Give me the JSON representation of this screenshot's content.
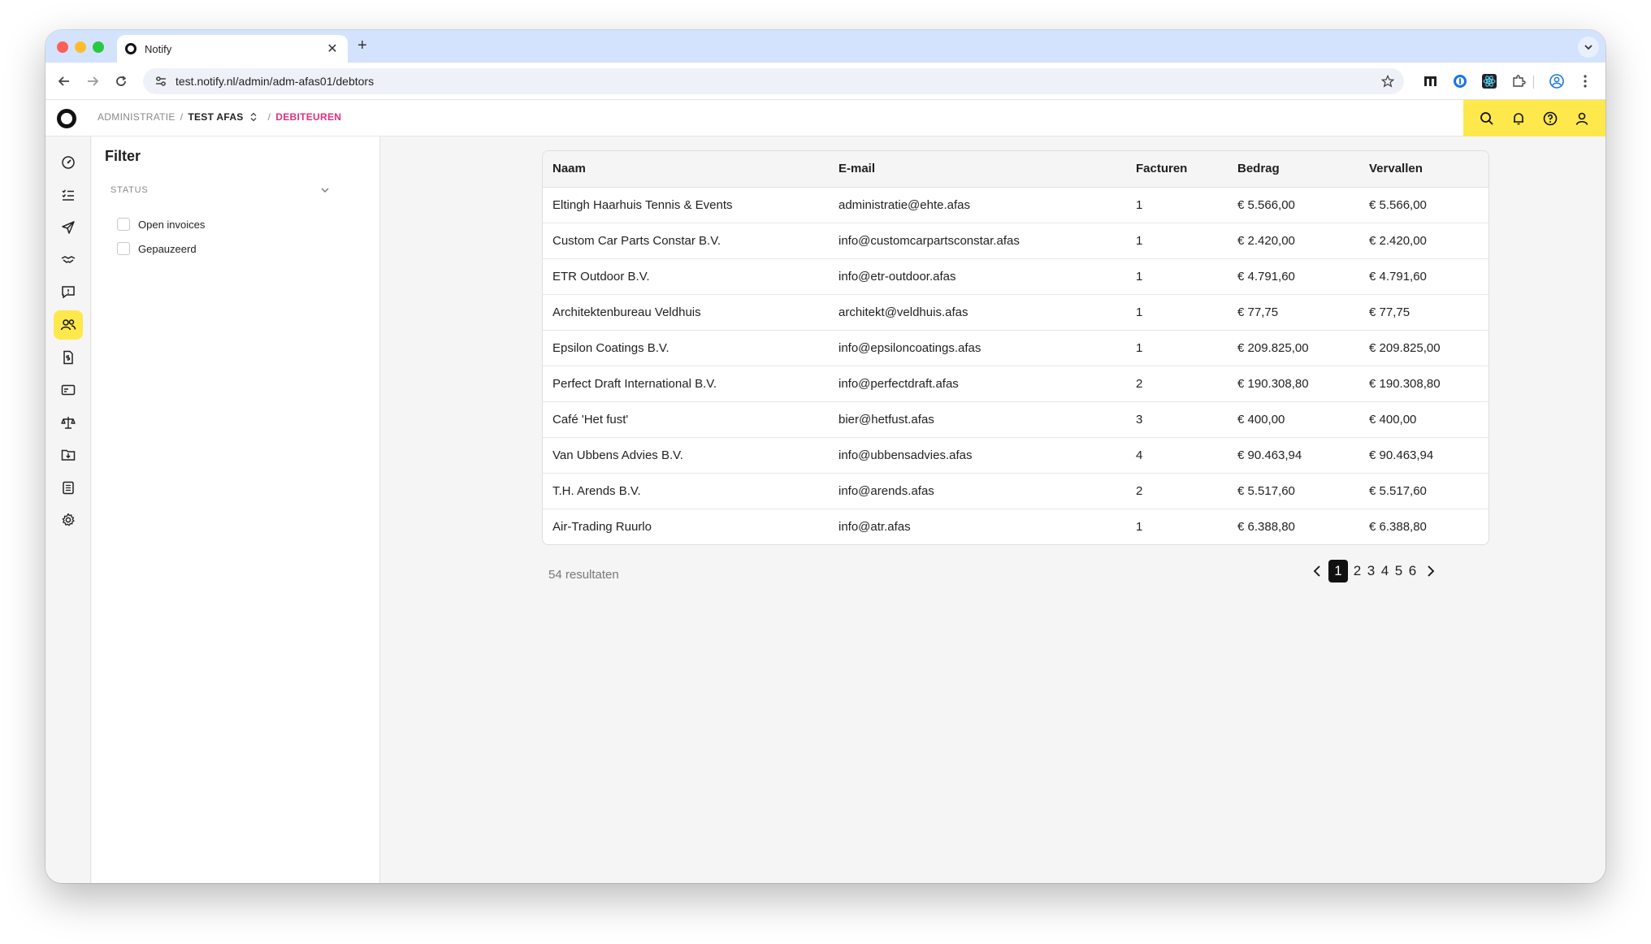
{
  "browser": {
    "tab_title": "Notify",
    "url": "test.notify.nl/admin/adm-afas01/debtors"
  },
  "header": {
    "breadcrumb_admin": "ADMINISTRATIE",
    "breadcrumb_sep": "/",
    "breadcrumb_client": "TEST AFAS",
    "breadcrumb_current": "DEBITEUREN"
  },
  "filter": {
    "title": "Filter",
    "section_label": "STATUS",
    "options": [
      {
        "label": "Open invoices",
        "checked": false
      },
      {
        "label": "Gepauzeerd",
        "checked": false
      }
    ]
  },
  "table": {
    "columns": [
      "Naam",
      "E-mail",
      "Facturen",
      "Bedrag",
      "Vervallen"
    ],
    "rows": [
      [
        "Eltingh Haarhuis Tennis & Events",
        "administratie@ehte.afas",
        "1",
        "€ 5.566,00",
        "€ 5.566,00"
      ],
      [
        "Custom Car Parts Constar B.V.",
        "info@customcarpartsconstar.afas",
        "1",
        "€ 2.420,00",
        "€ 2.420,00"
      ],
      [
        "ETR Outdoor B.V.",
        "info@etr-outdoor.afas",
        "1",
        "€ 4.791,60",
        "€ 4.791,60"
      ],
      [
        "Architektenbureau Veldhuis",
        "architekt@veldhuis.afas",
        "1",
        "€ 77,75",
        "€ 77,75"
      ],
      [
        "Epsilon Coatings B.V.",
        "info@epsiloncoatings.afas",
        "1",
        "€ 209.825,00",
        "€ 209.825,00"
      ],
      [
        "Perfect Draft International B.V.",
        "info@perfectdraft.afas",
        "2",
        "€ 190.308,80",
        "€ 190.308,80"
      ],
      [
        "Café 'Het fust'",
        "bier@hetfust.afas",
        "3",
        "€ 400,00",
        "€ 400,00"
      ],
      [
        "Van Ubbens Advies B.V.",
        "info@ubbensadvies.afas",
        "4",
        "€ 90.463,94",
        "€ 90.463,94"
      ],
      [
        "T.H. Arends B.V.",
        "info@arends.afas",
        "2",
        "€ 5.517,60",
        "€ 5.517,60"
      ],
      [
        "Air-Trading Ruurlo",
        "info@atr.afas",
        "1",
        "€ 6.388,80",
        "€ 6.388,80"
      ]
    ]
  },
  "pagination": {
    "results_text": "54 resultaten",
    "pages": [
      "1",
      "2",
      "3",
      "4",
      "5",
      "6"
    ],
    "current_page": "1"
  },
  "colors": {
    "accent": "#fee84c",
    "breadcrumb_active": "#e0307e",
    "chrome_tabstrip": "#d3e3fd"
  }
}
